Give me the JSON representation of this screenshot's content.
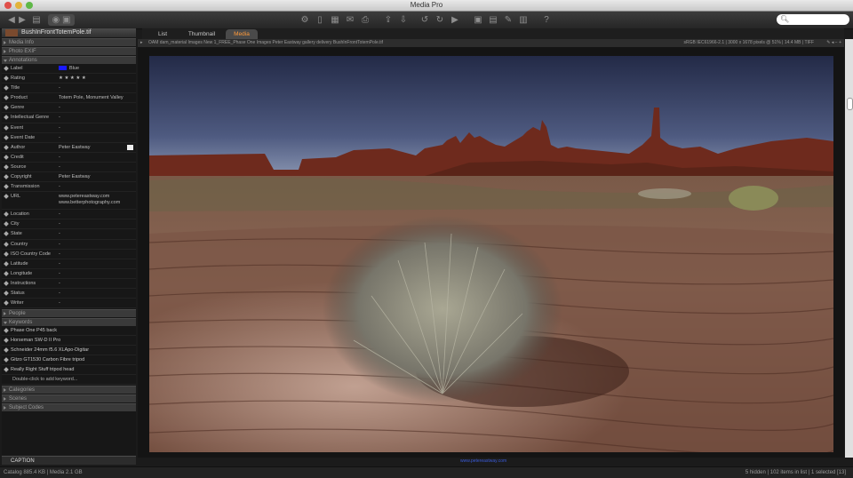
{
  "window": {
    "title": "Media Pro"
  },
  "search": {
    "placeholder": ""
  },
  "tabs": [
    {
      "label": "List"
    },
    {
      "label": "Thumbnail"
    },
    {
      "label": "Media"
    }
  ],
  "file": {
    "name": "BushInFrontTotemPole.tif"
  },
  "sections": {
    "media_info": "Media Info",
    "photo_exif": "Photo EXIF",
    "annotations": "Annotations",
    "people": "People",
    "keywords": "Keywords",
    "categories": "Categories",
    "scenes": "Scenes",
    "subject_codes": "Subject Codes"
  },
  "annotations": [
    {
      "label": "Label",
      "value": "Blue"
    },
    {
      "label": "Rating",
      "value": "★ ★ ★ ★ ★"
    },
    {
      "label": "Title",
      "value": "-"
    },
    {
      "label": "Product",
      "value": "Totem Pole, Monument Valley"
    },
    {
      "label": "Genre",
      "value": "-"
    },
    {
      "label": "Intellectual Genre",
      "value": "-"
    },
    {
      "label": "Event",
      "value": "-"
    },
    {
      "label": "Event Date",
      "value": "-"
    },
    {
      "label": "Author",
      "value": "Peter Eastway"
    },
    {
      "label": "Credit",
      "value": "-"
    },
    {
      "label": "Source",
      "value": "-"
    },
    {
      "label": "Copyright",
      "value": "Peter Eastway"
    },
    {
      "label": "Transmission",
      "value": "-"
    },
    {
      "label": "URL",
      "value": "www.petereastway.com",
      "value2": "www.betterphotography.com"
    },
    {
      "label": "Location",
      "value": "-"
    },
    {
      "label": "City",
      "value": "-"
    },
    {
      "label": "State",
      "value": "-"
    },
    {
      "label": "Country",
      "value": "-"
    },
    {
      "label": "ISO Country Code",
      "value": "-"
    },
    {
      "label": "Latitude",
      "value": "-"
    },
    {
      "label": "Longitude",
      "value": "-"
    },
    {
      "label": "Instructions",
      "value": "-"
    },
    {
      "label": "Status",
      "value": "-"
    },
    {
      "label": "Writer",
      "value": "-"
    }
  ],
  "keywords": [
    "Phase One P45 back",
    "Horseman SW-D II Pro",
    "Schneider 24mm f5.6 XLApo-Digitar",
    "Gitzo GT1530 Carbon Fibre tripod",
    "Really Right Stuff tripod head"
  ],
  "keywords_add": "Double-click to add keyword...",
  "caption": {
    "label": "CAPTION"
  },
  "path": "OAM dam_material Images New 1_FREE_Phase One Images Peter Eastway gallery delivery BushInFrontTotemPole.tif",
  "media_meta": "sRGB IEC61966-2.1  |  3000 x 1678 pixels @ 51%  |  14.4 MB  |  TIFF",
  "photo_credit": "www.petereastway.com",
  "status": {
    "left": "Catalog  885.4 KB  |  Media 2.1 GB",
    "right": "5 hidden   |   102 items in list   |   1 selected [13]"
  },
  "colors": {
    "accent": "#ff9a3a",
    "label_blue": "#1a1aff"
  }
}
